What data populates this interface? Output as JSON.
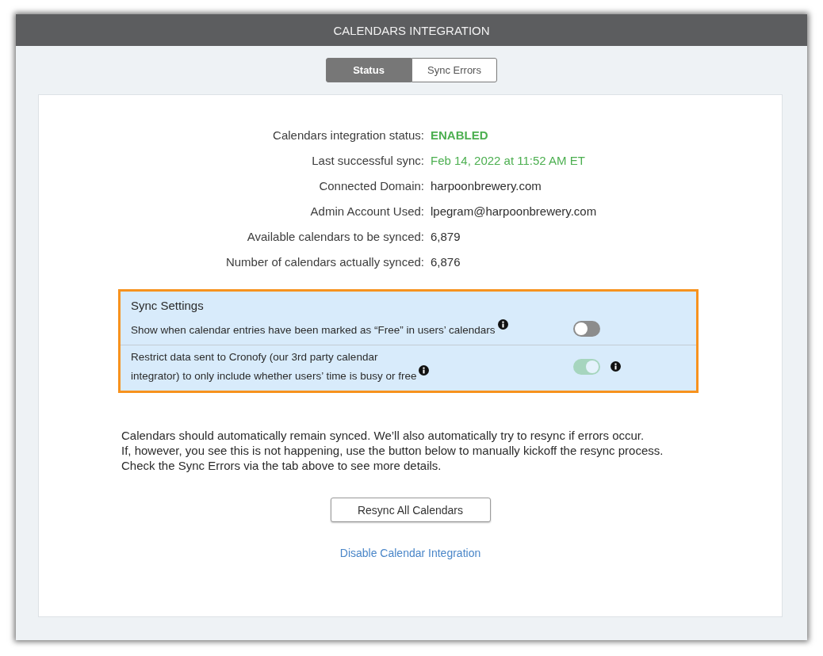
{
  "window": {
    "title": "CALENDARS INTEGRATION"
  },
  "tabs": [
    {
      "label": "Status",
      "selected": true
    },
    {
      "label": "Sync Errors",
      "selected": false
    }
  ],
  "status_rows": [
    {
      "label": "Calendars integration status:",
      "value": "ENABLED",
      "kind": "status"
    },
    {
      "label": "Last successful sync:",
      "value": "Feb 14, 2022 at 11:52 AM ET",
      "kind": "success"
    },
    {
      "label": "Connected Domain:",
      "value": "harpoonbrewery.com",
      "kind": "plain"
    },
    {
      "label": "Admin Account Used:",
      "value": "lpegram@harpoonbrewery.com",
      "kind": "plain"
    },
    {
      "label": "Available calendars to be synced:",
      "value": "6,879",
      "kind": "plain"
    },
    {
      "label": "Number of calendars actually synced:",
      "value": "6,876",
      "kind": "plain"
    }
  ],
  "sync_settings": {
    "title": "Sync Settings",
    "highlighted": true,
    "rows": [
      {
        "label": "Show when calendar entries have been marked as “Free” in users’ calendars",
        "on": false,
        "disabled": false,
        "toggle_info": false
      },
      {
        "label": "Restrict data sent to Cronofy (our 3rd party calendar\nintegrator) to only include whether users’ time is busy or free",
        "on": true,
        "disabled": true,
        "toggle_info": true
      }
    ]
  },
  "notice": "Calendars should automatically remain synced. We’ll also automatically try to resync if errors occur.\nIf, however, you see this is not happening, use the button below to manually kickoff the resync process.\nCheck the Sync Errors via the tab above to see more details.",
  "resync_button": "Resync All Calendars",
  "disable_link": "Disable Calendar Integration"
}
